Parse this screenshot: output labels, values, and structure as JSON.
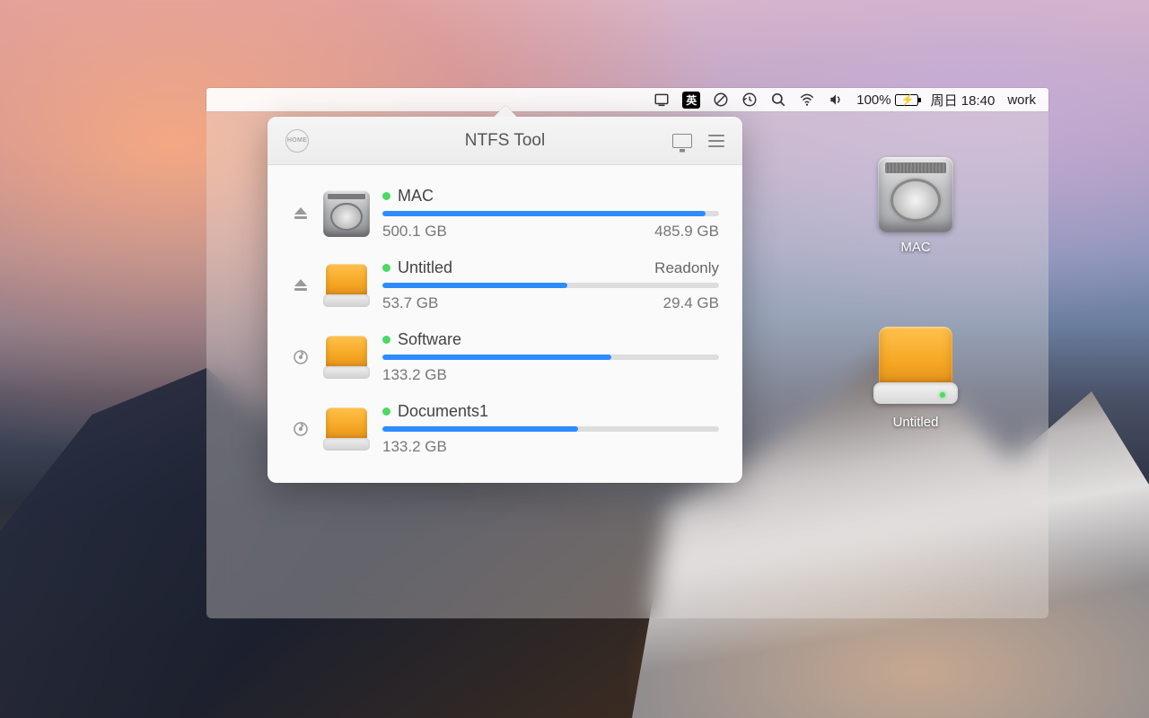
{
  "menubar": {
    "battery_pct": "100%",
    "clock": "周日 18:40",
    "user": "work",
    "ime": "英"
  },
  "panel": {
    "title": "NTFS Tool",
    "home_label": "HOME"
  },
  "volumes": [
    {
      "name": "MAC",
      "kind": "internal",
      "action": "eject",
      "total": "500.1 GB",
      "free": "485.9 GB",
      "tag": "",
      "fill_pct": 96
    },
    {
      "name": "Untitled",
      "kind": "external",
      "action": "eject",
      "total": "53.7 GB",
      "free": "29.4 GB",
      "tag": "Readonly",
      "fill_pct": 55
    },
    {
      "name": "Software",
      "kind": "external",
      "action": "refresh",
      "total": "133.2 GB",
      "free": "",
      "tag": "",
      "fill_pct": 68
    },
    {
      "name": "Documents1",
      "kind": "external",
      "action": "refresh",
      "total": "133.2 GB",
      "free": "",
      "tag": "",
      "fill_pct": 58
    }
  ],
  "desktop_drives": [
    {
      "name": "MAC",
      "kind": "internal"
    },
    {
      "name": "Untitled",
      "kind": "external"
    }
  ]
}
